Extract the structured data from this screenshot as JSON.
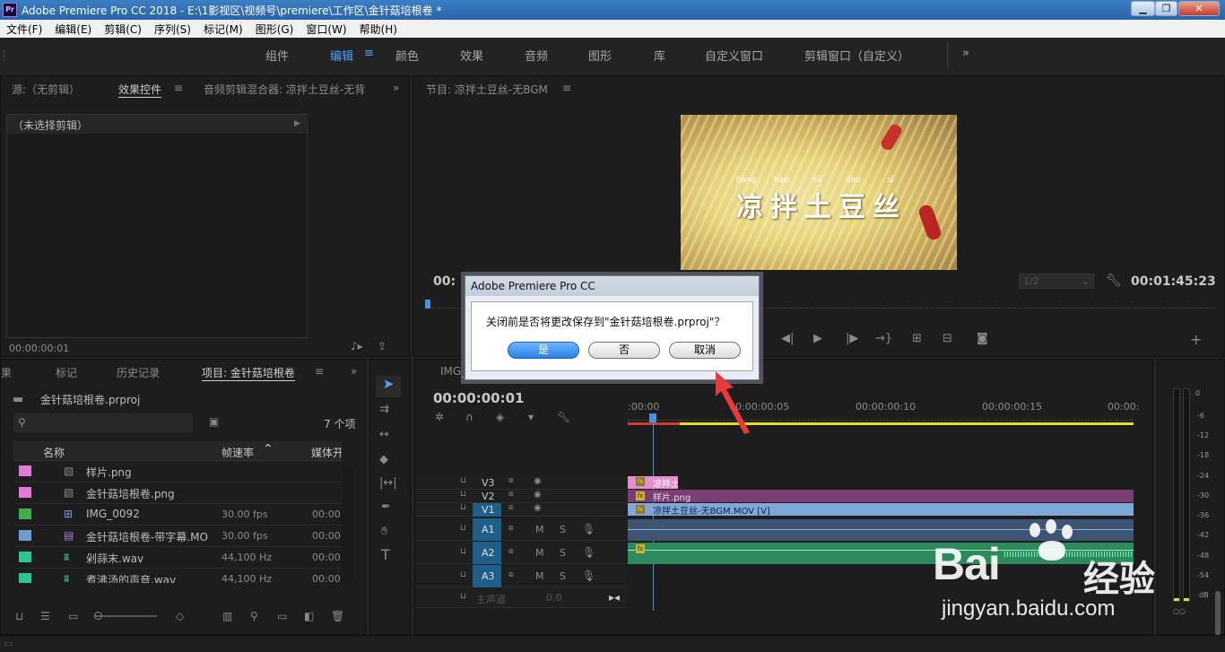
{
  "window": {
    "title": "Adobe Premiere Pro CC 2018 - E:\\1影视区\\视频号\\premiere\\工作区\\金针菇培根卷 *",
    "logo": "Pr",
    "min": "▁",
    "max": "❐",
    "close": "✕"
  },
  "menu": [
    "文件(F)",
    "编辑(E)",
    "剪辑(C)",
    "序列(S)",
    "标记(M)",
    "图形(G)",
    "窗口(W)",
    "帮助(H)"
  ],
  "workspaces": [
    "组件",
    "编辑",
    "颜色",
    "效果",
    "音频",
    "图形",
    "库",
    "自定义窗口",
    "剪辑窗口（自定义）"
  ],
  "workspace_more": "»",
  "source_panel": {
    "tabs": [
      "源:（无剪辑）",
      "效果控件",
      "音频剪辑混合器: 凉拌土豆丝-无背"
    ],
    "more": "»",
    "clip_header": "（未选择剪辑）",
    "timecode": "00:00:00:01"
  },
  "program_panel": {
    "title": "节目: 凉拌土豆丝-无BGM",
    "timecode_left": "00:",
    "timecode_right": "00:01:45:23",
    "resolution": "1/2",
    "frame": {
      "pinyin": [
        "liáng",
        "bàn",
        "tǔ",
        "dòu",
        "sī"
      ],
      "caption": "凉拌土豆丝"
    }
  },
  "project_panel": {
    "tabs": [
      "果",
      "标记",
      "历史记录",
      "项目: 金针菇培根卷"
    ],
    "more": "»",
    "file": "金针菇培根卷.prproj",
    "item_count": "7 个项",
    "columns": [
      "名称",
      "帧速率",
      "媒体开始"
    ],
    "items": [
      {
        "color": "#e27ad7",
        "name": "样片.png",
        "fps": "",
        "start": "",
        "icon": "image-icon"
      },
      {
        "color": "#e27ad7",
        "name": "金针菇培根卷.png",
        "fps": "",
        "start": "",
        "icon": "image-icon"
      },
      {
        "color": "#3fae4a",
        "name": "IMG_0092",
        "fps": "30.00 fps",
        "start": "00:00:0",
        "icon": "sequence-icon"
      },
      {
        "color": "#6e9bd0",
        "name": "金针菇培根卷-带字幕.MO",
        "fps": "30.00 fps",
        "start": "00:00:0",
        "icon": "video-icon"
      },
      {
        "color": "#2ec592",
        "name": "剁蒜末.wav",
        "fps": "44,100 Hz",
        "start": "00:00:0",
        "icon": "audio-icon"
      },
      {
        "color": "#2ec592",
        "name": "煮沸汤的声音.wav",
        "fps": "44,100 Hz",
        "start": "00:00:0",
        "icon": "audio-icon"
      }
    ]
  },
  "timeline": {
    "tab": "IMG_",
    "timecode": "00:00:00:01",
    "ruler": [
      ":00:00",
      "00:00:00:05",
      "00:00:00:10",
      "00:00:00:15",
      "00:00:"
    ],
    "tracks": [
      {
        "id": "V3",
        "clip": "凉拌土",
        "clip_color": "#e58fd0"
      },
      {
        "id": "V2",
        "clip": "样片.png",
        "clip_color": "#7a3d74"
      },
      {
        "id": "V1",
        "clip": "凉拌土豆丝-无BGM.MOV [V]",
        "clip_color": "#7fa8d8"
      },
      {
        "id": "A1",
        "clip": "",
        "clip_color": "#3d5572"
      },
      {
        "id": "A2",
        "clip": "",
        "clip_color": "#2c8a5d"
      },
      {
        "id": "A3",
        "clip": "",
        "clip_color": ""
      }
    ],
    "master": "主声道",
    "master_val": "0.0",
    "track_toggle": [
      "M",
      "S"
    ]
  },
  "meter": {
    "ticks": [
      "0",
      "-6",
      "-12",
      "-18",
      "-24",
      "-30",
      "-36",
      "-42",
      "-48",
      "-54",
      "dB"
    ]
  },
  "dialog": {
    "title": "Adobe Premiere Pro CC",
    "message": "关闭前是否将更改保存到\"金针菇培根卷.prproj\"？",
    "yes": "是",
    "no": "否",
    "cancel": "取消"
  },
  "watermark": {
    "brand": "Bai",
    "brand2": "经验",
    "url": "jingyan.baidu.com"
  },
  "colors": {
    "accent": "#4fa3ff",
    "playhead": "#4a8fe0",
    "dialog_default": "#2a7fe8",
    "arrow": "#e83a3a"
  }
}
